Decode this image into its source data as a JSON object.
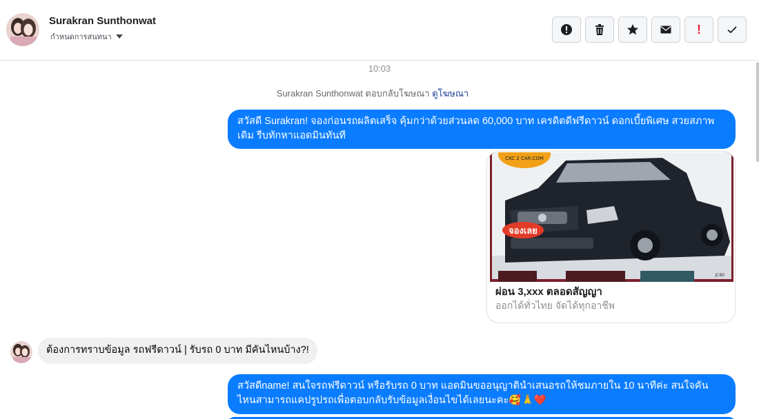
{
  "header": {
    "contact_name": "Surakran Sunthonwat",
    "conversation_label": "กำหนดการสนทนา",
    "actions": [
      {
        "icon": "alert-circle-icon",
        "label": "Report"
      },
      {
        "icon": "trash-icon",
        "label": "Delete"
      },
      {
        "icon": "star-icon",
        "label": "Star"
      },
      {
        "icon": "envelope-icon",
        "label": "Mark unread"
      },
      {
        "icon": "exclamation-icon",
        "label": "!"
      },
      {
        "icon": "checkmark-icon",
        "label": "Done"
      }
    ]
  },
  "thread": {
    "time": "10:03",
    "ad_reply_prefix": "Surakran Sunthonwat ตอบกลับโฆษณา",
    "ad_reply_link": "ดูโฆษณา",
    "messages": [
      {
        "from": "page",
        "text": "สวัสดี Surakran! จองก่อนรถผลิตเสร็จ คุ้มกว่าด้วยส่วนลด 60,000 บาท เครดิตดีฟรีดาวน์ ดอกเบี้ยพิเศษ สวยสภาพเดิม รีบทักหาแอดมินทันที"
      },
      {
        "from": "user",
        "text": "ต้องการทราบข้อมูล รถฟรีดาวน์ | รับรถ 0 บาท มีคันไหนบ้าง?!"
      },
      {
        "from": "page",
        "text": "สวัสดีname! สนใจรถฟรีดาวน์ หรือรับรถ 0 บาท แอดมินขออนุญาตินำเสนอรถให้ชมภายใน 10 นาทีค่ะ สนใจคันไหนสามารถแคปรูปรถเพื่อตอบกลับรับข้อมูลเงื่อนไขได้เลยนะคะ🥰🙏❤️"
      },
      {
        "from": "page",
        "text": ""
      }
    ],
    "ad_card": {
      "image_badge": "จองเลย",
      "image_logo": "CKC 2 CAR.COM",
      "image_code": "JC80",
      "title": "ผ่อน 3,xxx ตลอดสัญญา",
      "subtitle": "ออกได้ทั่วไทย จัดได้ทุกอาชีพ"
    }
  }
}
